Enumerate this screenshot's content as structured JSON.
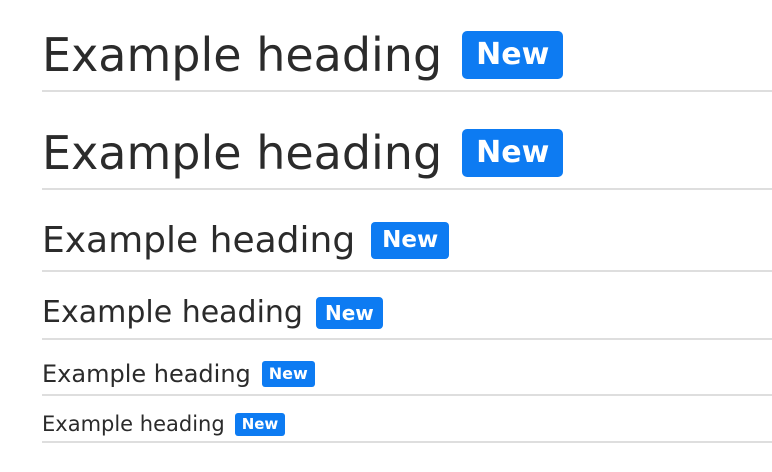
{
  "headings": [
    {
      "level": "h1",
      "text": "Example heading",
      "badge": "New"
    },
    {
      "level": "h2",
      "text": "Example heading",
      "badge": "New"
    },
    {
      "level": "h3",
      "text": "Example heading",
      "badge": "New"
    },
    {
      "level": "h4",
      "text": "Example heading",
      "badge": "New"
    },
    {
      "level": "h5",
      "text": "Example heading",
      "badge": "New"
    },
    {
      "level": "h6",
      "text": "Example heading",
      "badge": "New"
    }
  ],
  "colors": {
    "badge_background": "#0d7bf2",
    "badge_text": "#ffffff",
    "heading_text": "#2b2b2b",
    "divider": "#dedede"
  }
}
